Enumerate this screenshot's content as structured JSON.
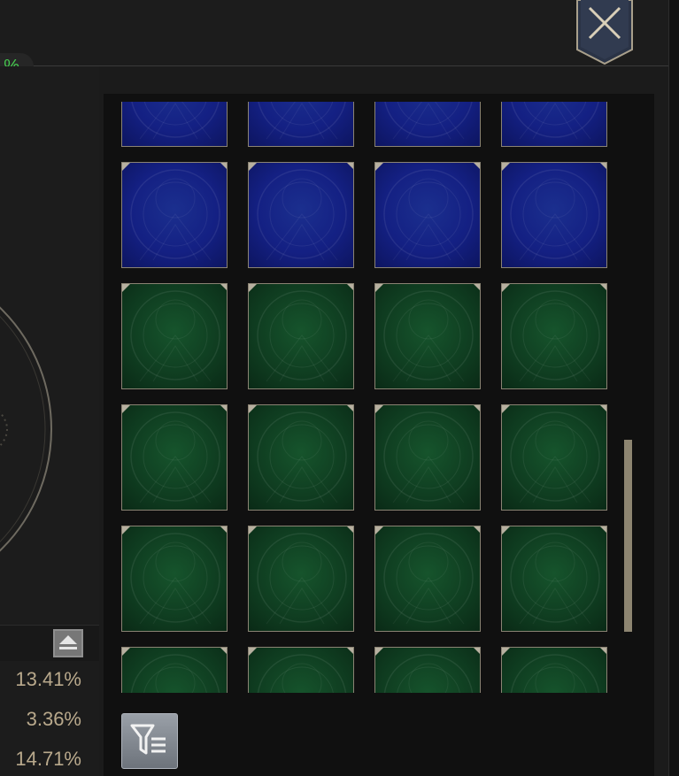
{
  "header": {
    "percent_fragment": "%",
    "close_icon": "close-x-icon"
  },
  "stats": {
    "collapse_icon": "eject-up-icon",
    "values": [
      "13.41%",
      "3.36%",
      "14.71%"
    ]
  },
  "colors": {
    "accent_green": "#45c84e",
    "stat_text": "#b9a98c",
    "slot_blue": "#142083",
    "slot_green": "#0f3c20",
    "scroll_thumb": "#8d8571"
  },
  "grid": {
    "columns": 4,
    "rows": [
      {
        "color": "blue"
      },
      {
        "color": "blue"
      },
      {
        "color": "green"
      },
      {
        "color": "green"
      },
      {
        "color": "green"
      },
      {
        "color": "green"
      }
    ]
  },
  "filter": {
    "icon": "filter-list-icon"
  }
}
